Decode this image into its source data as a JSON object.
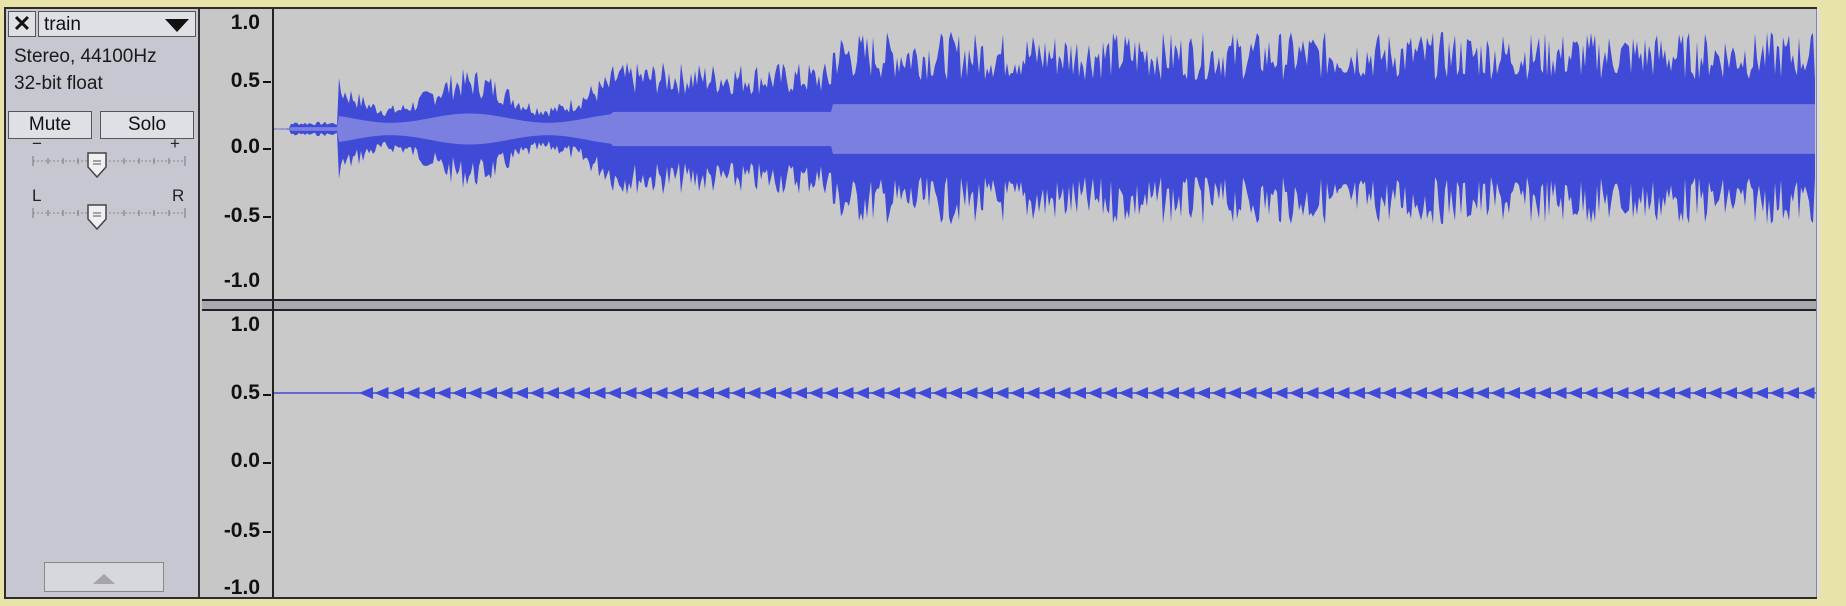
{
  "track": {
    "name": "train",
    "info_line1": "Stereo, 44100Hz",
    "info_line2": "32-bit float",
    "mute_label": "Mute",
    "solo_label": "Solo",
    "gain_minus": "−",
    "gain_plus": "+",
    "pan_left": "L",
    "pan_right": "R",
    "gain_level": 0.41,
    "pan_level": 0.41
  },
  "channel1": {
    "ruler": [
      "1.0",
      "0.5",
      "0.0",
      "-0.5",
      "-1.0"
    ]
  },
  "channel2": {
    "ruler": [
      "1.0",
      "0.5",
      "0.0",
      "-0.5",
      "-1.0"
    ]
  },
  "colors": {
    "waveform": "#3f4ad6",
    "waveform_rms": "#7b7fdf",
    "background": "#c9c9c9",
    "panel": "#c6c7d0",
    "window_border": "#e8e3a8"
  },
  "icons": {
    "close": "close-icon",
    "menu": "dropdown-arrow-icon",
    "collapse": "collapse-arrow-icon",
    "slider_thumb": "slider-thumb-icon"
  }
}
